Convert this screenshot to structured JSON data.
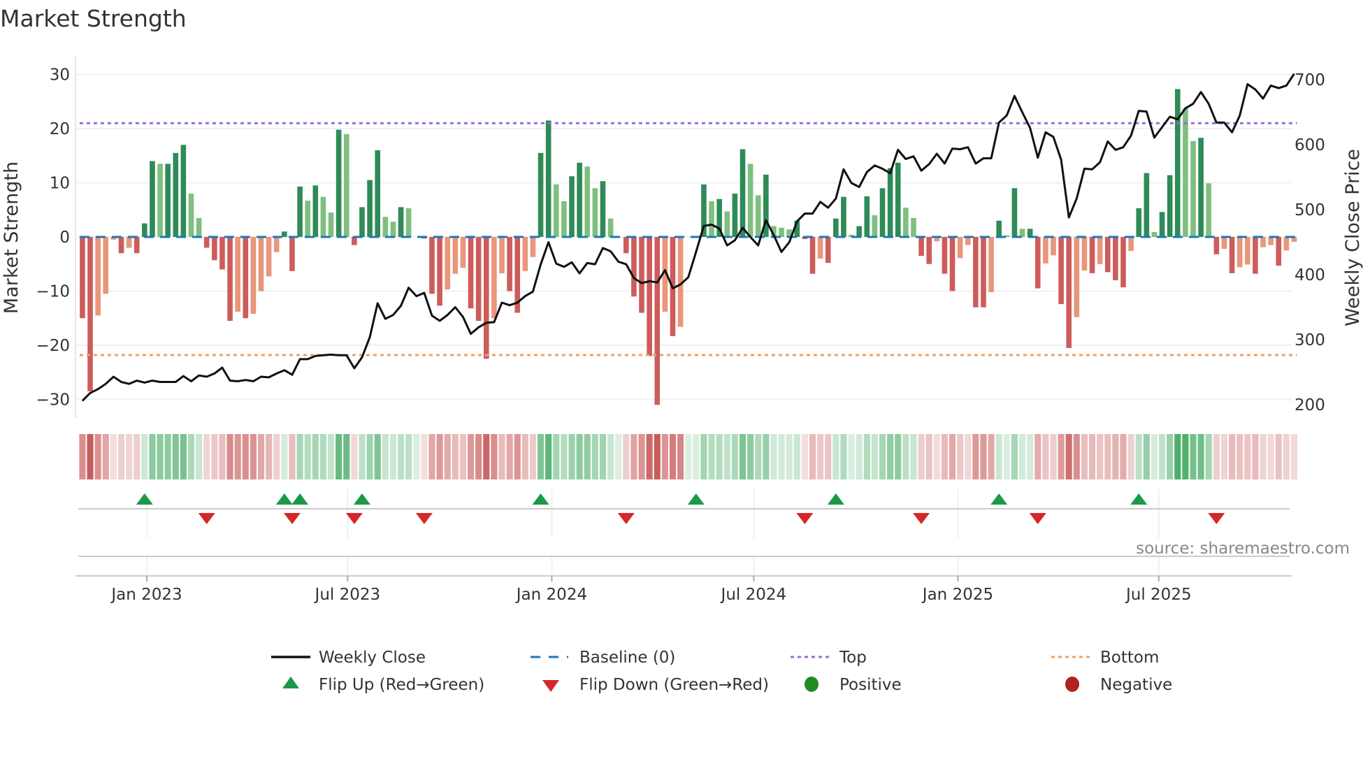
{
  "chart_data": {
    "type": "bar",
    "title": "Market Strength",
    "ylabel": "Market Strength",
    "y2label": "Weekly Close Price",
    "ylim": [
      -33,
      33
    ],
    "y2lim": [
      190,
      715
    ],
    "yticks": [
      "30",
      "20",
      "10",
      "0",
      "−10",
      "−20",
      "−30"
    ],
    "ytick_values": [
      30,
      20,
      10,
      0,
      -10,
      -20,
      -30
    ],
    "y2ticks": [
      "700",
      "600",
      "500",
      "400",
      "300",
      "200"
    ],
    "y2tick_values": [
      700,
      600,
      500,
      400,
      300,
      200
    ],
    "xticks": [
      "Jan 2023",
      "Jul 2023",
      "Jan 2024",
      "Jul 2024",
      "Jan 2025",
      "Jul 2025"
    ],
    "xtick_dates": [
      "2023-01-01",
      "2023-07-01",
      "2024-01-01",
      "2024-07-01",
      "2025-01-01",
      "2025-07-01"
    ],
    "grid": true,
    "frequency": "weekly",
    "start_date": "2022-11-04",
    "top_level": 21.0,
    "bottom_level": -21.8,
    "baseline": 0,
    "strength": [
      -15,
      -28.5,
      -14.5,
      -10.5,
      -0.5,
      -3,
      -2,
      -3,
      2.5,
      14,
      13.5,
      13.5,
      15.5,
      17,
      8,
      3.5,
      -2,
      -4.3,
      -6,
      -15.5,
      -13.8,
      -15,
      -14.2,
      -10,
      -7.3,
      -2.8,
      1,
      -6.3,
      9.3,
      6.7,
      9.5,
      7.4,
      4.5,
      19.8,
      19,
      -1.5,
      5.5,
      10.5,
      16,
      3.7,
      2.8,
      5.5,
      5.3,
      0,
      -0.3,
      -10.5,
      -12.7,
      -9.7,
      -6.8,
      -5.7,
      -13.2,
      -15.5,
      -22.5,
      -15,
      -6.7,
      -10,
      -14,
      -6.3,
      -3.7,
      15.5,
      21.5,
      9.7,
      6.6,
      11.2,
      13.7,
      13,
      9,
      10.3,
      3.4,
      0,
      -3,
      -11,
      -14,
      -22,
      -31,
      -13.8,
      -18.3,
      -16.6,
      0,
      0,
      9.7,
      6.6,
      7,
      4.7,
      8,
      16.2,
      13.5,
      7.7,
      11.5,
      2,
      1.7,
      1.4,
      3,
      -0.4,
      -6.8,
      -4,
      -4.8,
      3.4,
      7.4,
      0.4,
      2,
      7.5,
      4,
      9,
      12.7,
      13.7,
      5.4,
      3.5,
      -3.5,
      -5,
      -0.8,
      -6.8,
      -10,
      -3.9,
      -1.5,
      -13,
      -13,
      -10.2,
      3,
      0.3,
      9,
      1.5,
      1.5,
      -9.5,
      -4.9,
      -3.4,
      -12.4,
      -20.5,
      -14.8,
      -6.2,
      -6.7,
      -5,
      -6.5,
      -8,
      -9.3,
      -2.6,
      5.3,
      11.8,
      0.9,
      4.6,
      11.4,
      27.3,
      23.7,
      17.7,
      18.3,
      9.9,
      -3.2,
      -2.2,
      -6.7,
      -5.6,
      -5.1,
      -6.8,
      -1.9,
      -1.5,
      -5.3,
      -2.5,
      -0.9
    ],
    "weekly_close": [
      206,
      218,
      224,
      232,
      243,
      235,
      232,
      237,
      234,
      237,
      235,
      235,
      235,
      244,
      236,
      245,
      243,
      248,
      257,
      237,
      236,
      238,
      236,
      243,
      242,
      248,
      253,
      246,
      270,
      270,
      275,
      276,
      277,
      276,
      276,
      256,
      273,
      304,
      356,
      332,
      338,
      352,
      380,
      367,
      372,
      337,
      329,
      338,
      350,
      335,
      309,
      319,
      326,
      327,
      357,
      353,
      357,
      367,
      374,
      416,
      450,
      417,
      412,
      419,
      402,
      418,
      416,
      441,
      436,
      420,
      416,
      395,
      387,
      390,
      388,
      407,
      379,
      385,
      396,
      435,
      475,
      477,
      471,
      445,
      453,
      472,
      458,
      445,
      484,
      461,
      435,
      450,
      482,
      494,
      494,
      512,
      503,
      517,
      562,
      541,
      535,
      558,
      568,
      563,
      556,
      592,
      578,
      582,
      560,
      570,
      586,
      571,
      594,
      593,
      596,
      571,
      579,
      579,
      634,
      645,
      675,
      650,
      626,
      580,
      619,
      612,
      577,
      488,
      517,
      563,
      562,
      573,
      605,
      592,
      596,
      614,
      652,
      651,
      611,
      627,
      643,
      639,
      656,
      663,
      681,
      663,
      634,
      634,
      619,
      645,
      693,
      685,
      671,
      691,
      687,
      691,
      709
    ],
    "flip_up": [
      "2022-12-30",
      "2023-05-05",
      "2023-05-19",
      "2023-07-14",
      "2023-12-22",
      "2024-05-10",
      "2024-09-13",
      "2025-02-07",
      "2025-06-13"
    ],
    "flip_down": [
      "2023-02-24",
      "2023-05-12",
      "2023-07-07",
      "2023-09-08",
      "2024-03-08",
      "2024-08-16",
      "2024-11-29",
      "2025-03-14",
      "2025-08-22"
    ],
    "legend": {
      "placement": "bottom",
      "weekly_close": "Weekly Close",
      "baseline": "Baseline (0)",
      "top": "Top",
      "bottom": "Bottom",
      "flip_up": "Flip Up (Red→Green)",
      "flip_down": "Flip Down (Green→Red)",
      "positive": "Positive",
      "negative": "Negative"
    },
    "source": "source: sharemaestro.com"
  },
  "colors": {
    "pos_strong": "#2e8b57",
    "pos_weak": "#7fbf7f",
    "neg_strong": "#cd5c5c",
    "neg_weak": "#e9967a",
    "close": "#111111",
    "baseline": "#1f77b4",
    "top": "#9b6bd6",
    "bottom": "#f0a060",
    "flip_up": "#1a9a48",
    "flip_down": "#d62728",
    "positive": "#228b22",
    "negative": "#b22222"
  }
}
